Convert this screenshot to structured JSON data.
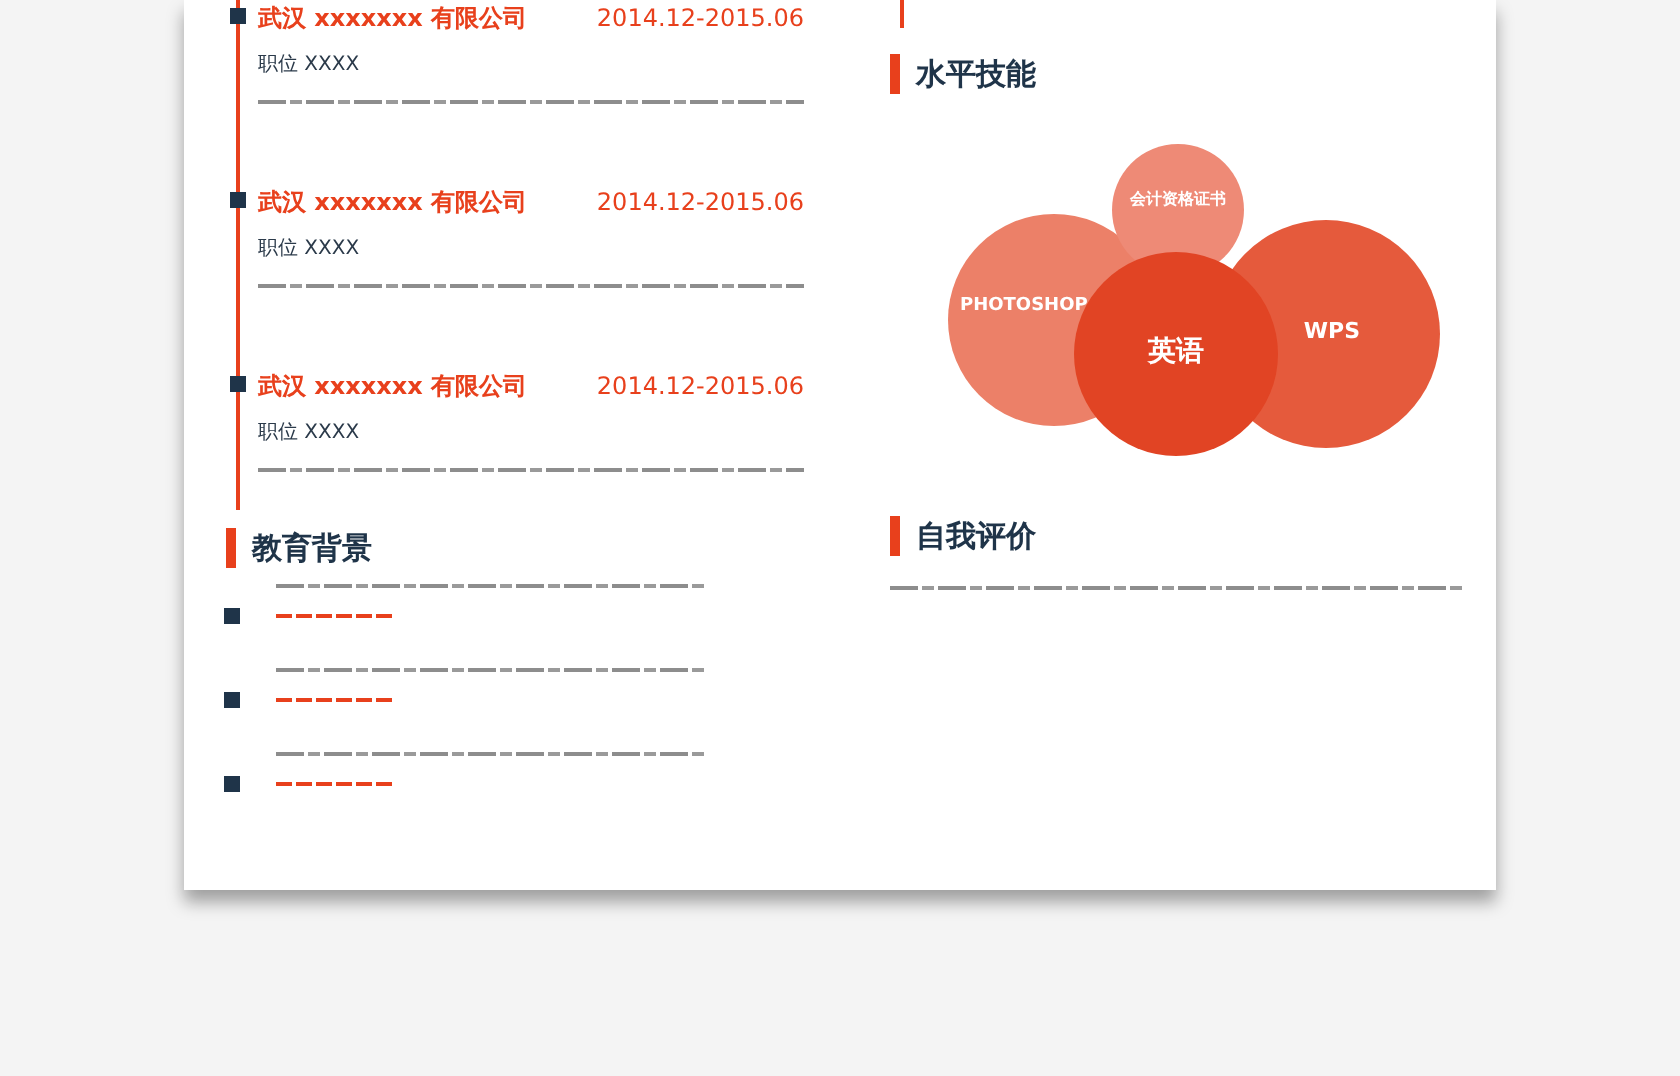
{
  "experience": {
    "entries": [
      {
        "company": "武汉 xxxxxxx 有限公司",
        "date": "2014.12-2015.06",
        "position": "职位 XXXX"
      },
      {
        "company": "武汉 xxxxxxx 有限公司",
        "date": "2014.12-2015.06",
        "position": "职位 XXXX"
      },
      {
        "company": "武汉 xxxxxxx 有限公司",
        "date": "2014.12-2015.06",
        "position": "职位 XXXX"
      }
    ]
  },
  "education": {
    "title": "教育背景"
  },
  "skills": {
    "title": "水平技能",
    "bubbles": [
      {
        "label": "PHOTOSHOP",
        "color": "#ec8068"
      },
      {
        "label": "会计资格证书",
        "color": "#ee8a76"
      },
      {
        "label": "WPS",
        "color": "#e55a3c"
      },
      {
        "label": "英语",
        "color": "#e14424"
      }
    ]
  },
  "self_evaluation": {
    "title": "自我评价"
  }
}
